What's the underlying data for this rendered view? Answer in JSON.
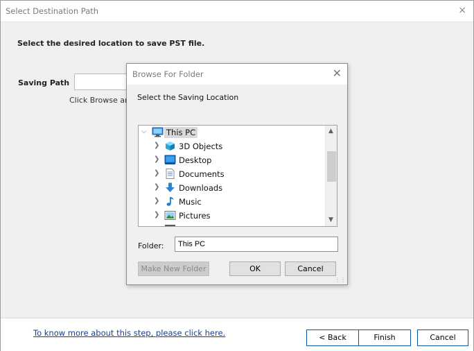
{
  "window": {
    "title": "Select Destination Path",
    "close_glyph": "×",
    "instruction": "Select the desired location to save PST file.",
    "saving_path_label": "Saving Path",
    "saving_path_value": "",
    "hint": "Click Browse and",
    "help_link": "To know more about this step, please click here.",
    "buttons": {
      "back": "< Back",
      "finish": "Finish",
      "cancel": "Cancel"
    }
  },
  "dialog": {
    "title": "Browse For Folder",
    "close_glyph": "✕",
    "prompt": "Select the Saving Location",
    "tree": [
      {
        "label": "This PC",
        "icon": "pc-icon",
        "expanded": true,
        "selected": true
      },
      {
        "label": "3D Objects",
        "icon": "3d-objects-icon"
      },
      {
        "label": "Desktop",
        "icon": "desktop-icon"
      },
      {
        "label": "Documents",
        "icon": "documents-icon"
      },
      {
        "label": "Downloads",
        "icon": "downloads-icon"
      },
      {
        "label": "Music",
        "icon": "music-icon"
      },
      {
        "label": "Pictures",
        "icon": "pictures-icon"
      }
    ],
    "folder_label": "Folder:",
    "folder_value": "This PC",
    "buttons": {
      "new_folder": "Make New Folder",
      "ok": "OK",
      "cancel": "Cancel"
    }
  },
  "colors": {
    "accent_border": "#0b5aa8",
    "link": "#1a3e8c",
    "selection": "#d9d9d9"
  }
}
